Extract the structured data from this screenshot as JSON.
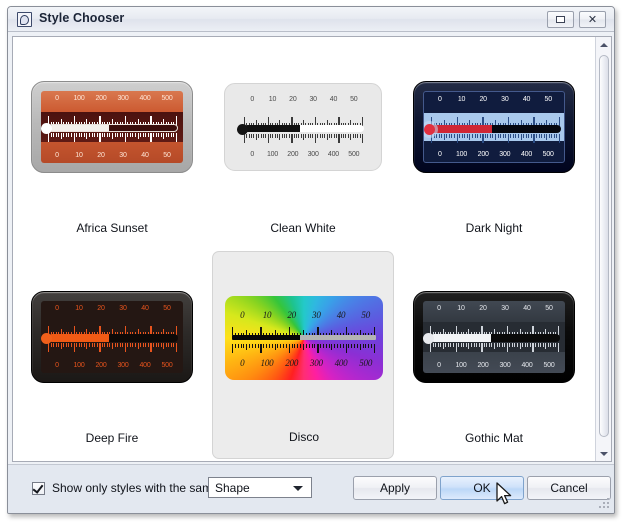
{
  "window": {
    "title": "Style Chooser",
    "icon": "style-chooser-icon",
    "restore_label": "□",
    "close_label": "✕"
  },
  "scrollbar": {
    "up_icon": "scroll-up-arrow-icon",
    "down_icon": "scroll-down-arrow-icon"
  },
  "styles": [
    {
      "name": "Africa Sunset",
      "selected": false,
      "top_ticks": [
        "0",
        "100",
        "200",
        "300",
        "400",
        "500"
      ],
      "bottom_ticks": [
        "0",
        "10",
        "20",
        "30",
        "40",
        "50"
      ],
      "fill_percent": 47,
      "colors": {
        "frame": "#b9b9b9",
        "bg_top": "#d8744c",
        "bg_center": "#521612",
        "bg_bottom": "#c4552e",
        "text": "#ffe6d6",
        "tick": "#ffffff",
        "tube": "#f6f2ef",
        "fill": "#ffffff",
        "bulb": "#ffffff"
      }
    },
    {
      "name": "Clean White",
      "selected": false,
      "top_ticks": [
        "0",
        "10",
        "20",
        "30",
        "40",
        "50"
      ],
      "bottom_ticks": [
        "0",
        "100",
        "200",
        "300",
        "400",
        "500"
      ],
      "fill_percent": 47,
      "colors": {
        "frame": "#d2d2d2",
        "bg_top": "#e9e9e9",
        "bg_center": "#e9e9e9",
        "bg_bottom": "#e9e9e9",
        "text": "#4a4a4a",
        "tick": "#3a3a3a",
        "tube": "#ffffff",
        "fill": "#111111",
        "bulb": "#141414"
      }
    },
    {
      "name": "Dark Night",
      "selected": false,
      "top_ticks": [
        "0",
        "10",
        "20",
        "30",
        "40",
        "50"
      ],
      "bottom_ticks": [
        "0",
        "100",
        "200",
        "300",
        "400",
        "500"
      ],
      "fill_percent": 47,
      "colors": {
        "frame": "#0e1630",
        "bg_top": "#101c3e",
        "bg_center": "#b9d4f2",
        "bg_bottom": "#101c3e",
        "text": "#ffffff",
        "tick": "#2b4d86",
        "tube": "#05070f",
        "fill": "#cf2634",
        "bulb": "#e03040"
      }
    },
    {
      "name": "Deep Fire",
      "selected": false,
      "top_ticks": [
        "0",
        "10",
        "20",
        "30",
        "40",
        "50"
      ],
      "bottom_ticks": [
        "0",
        "100",
        "200",
        "300",
        "400",
        "500"
      ],
      "fill_percent": 47,
      "colors": {
        "frame": "#2d2a28",
        "bg_top": "#241713",
        "bg_center": "#241713",
        "bg_bottom": "#241713",
        "text": "#e8541d",
        "tick": "#e8541d",
        "tube": "#0d0907",
        "fill": "#ef5a15",
        "bulb": "#f1601b"
      }
    },
    {
      "name": "Disco",
      "selected": true,
      "top_ticks": [
        "0",
        "10",
        "20",
        "30",
        "40",
        "50"
      ],
      "bottom_ticks": [
        "0",
        "100",
        "200",
        "300",
        "400",
        "500"
      ],
      "fill_percent": 47,
      "colors": {
        "frame": "#ededed",
        "bg_top": "rainbow",
        "bg_center": "rainbow",
        "bg_bottom": "rainbow",
        "text": "#1a1a1a",
        "tick": "#1a1a1a",
        "tube": "#b4b4b4",
        "fill": "#060606",
        "bulb": "#060606"
      }
    },
    {
      "name": "Gothic Mat",
      "selected": false,
      "top_ticks": [
        "0",
        "10",
        "20",
        "30",
        "40",
        "50"
      ],
      "bottom_ticks": [
        "0",
        "100",
        "200",
        "300",
        "400",
        "500"
      ],
      "fill_percent": 47,
      "colors": {
        "frame": "#0a0a0a",
        "bg_top": "#3a4049",
        "bg_center": "#2a2f36",
        "bg_bottom": "#3a4049",
        "text": "#e4e7ec",
        "tick": "#cfd4db",
        "tube": "#0a0a0a",
        "fill": "#f1f3f6",
        "bulb": "#e8eaee"
      }
    }
  ],
  "footer": {
    "checkbox_label": "Show only styles with the same",
    "checkbox_checked": true,
    "combo_value": "Shape",
    "combo_icon": "chevron-down-icon",
    "apply_label": "Apply",
    "ok_label": "OK",
    "cancel_label": "Cancel"
  }
}
